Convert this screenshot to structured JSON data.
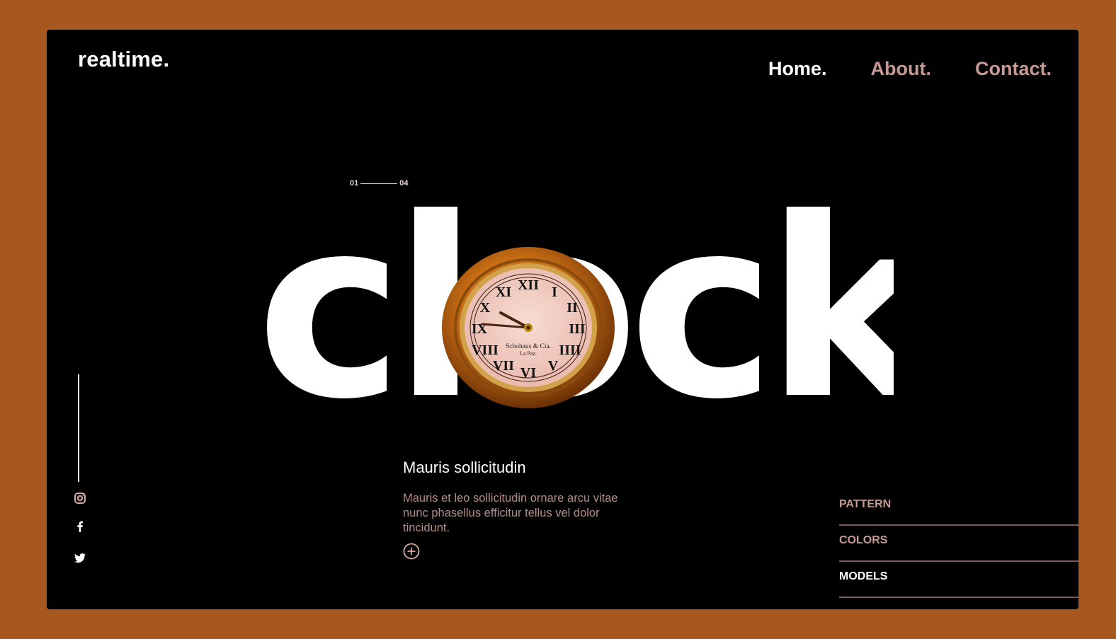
{
  "brand": {
    "logo": "realtime."
  },
  "nav": {
    "items": [
      {
        "label": "Home.",
        "active": true
      },
      {
        "label": "About.",
        "active": false
      },
      {
        "label": "Contact.",
        "active": false
      }
    ]
  },
  "slider": {
    "current": "01",
    "total": "04"
  },
  "hero": {
    "word": "clock",
    "clock_text": {
      "maker": "Schohaus & Cia.",
      "city": "La Paz."
    }
  },
  "description": {
    "title": "Mauris sollicitudin",
    "body": "Mauris et leo sollicitudin ornare arcu vitae nunc phasellus efficitur tellus vel dolor tincidunt."
  },
  "social": [
    "instagram-icon",
    "facebook-icon",
    "twitter-icon"
  ],
  "menu": {
    "items": [
      {
        "label": "PATTERN",
        "active": false
      },
      {
        "label": "COLORS",
        "active": false
      },
      {
        "label": "MODELS",
        "active": true
      }
    ]
  },
  "colors": {
    "page_background": "#a6581e",
    "frame_background": "#000000",
    "accent": "#c59a94",
    "text": "#ffffff"
  }
}
